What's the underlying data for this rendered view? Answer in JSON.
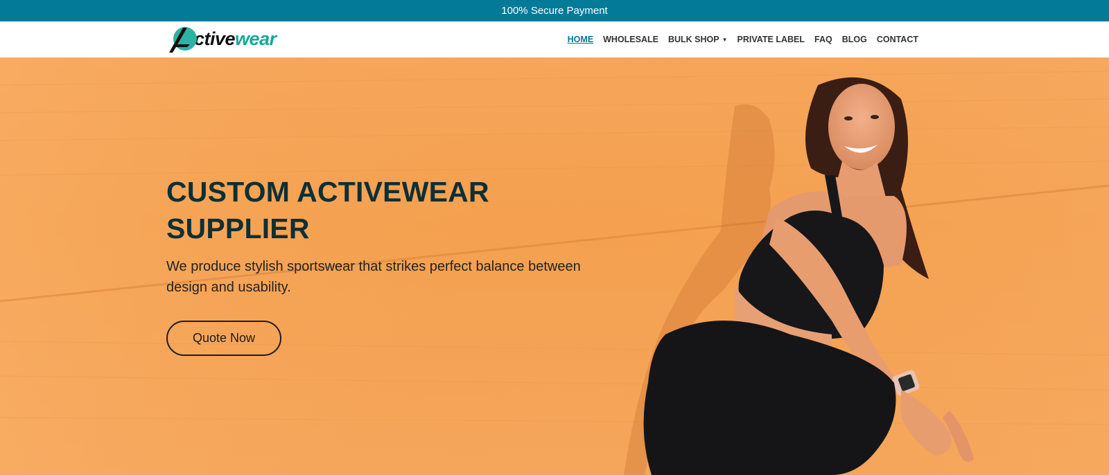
{
  "topbar": {
    "text": "100% Secure Payment"
  },
  "header": {
    "logo": {
      "part1": "ctive",
      "part2": "wear",
      "letter": "A"
    },
    "nav": [
      {
        "label": "HOME",
        "active": true
      },
      {
        "label": "WHOLESALE"
      },
      {
        "label": "BULK SHOP",
        "dropdown": true
      },
      {
        "label": "PRIVATE LABEL"
      },
      {
        "label": "FAQ"
      },
      {
        "label": "BLOG"
      },
      {
        "label": "CONTACT"
      }
    ]
  },
  "hero": {
    "title_line1": "CUSTOM ACTIVEWEAR",
    "title_line2": "SUPPLIER",
    "subtitle": "We produce stylish sportswear that strikes perfect balance between design and usability.",
    "cta_label": "Quote Now"
  },
  "colors": {
    "accent": "#047a99",
    "brand_teal": "#15a99c",
    "hero_bg": "#f4a04f",
    "heading": "#0f2f35"
  }
}
